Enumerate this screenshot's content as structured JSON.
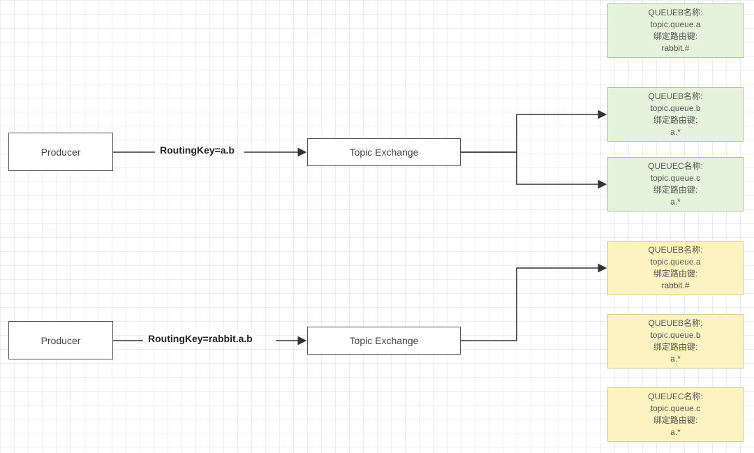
{
  "producers": [
    {
      "label": "Producer",
      "routing_key_label": "RoutingKey=a.b"
    },
    {
      "label": "Producer",
      "routing_key_label": "RoutingKey=rabbit.a.b"
    }
  ],
  "exchange_label": "Topic Exchange",
  "queues_top": [
    {
      "l1": "QUEUEB名称:",
      "l2": "topic.queue.a",
      "l3": "绑定路由键:",
      "l4": "rabbit.#"
    },
    {
      "l1": "QUEUEB名称:",
      "l2": "topic.queue.b",
      "l3": "绑定路由键:",
      "l4": "a.*"
    },
    {
      "l1": "QUEUEC名称:",
      "l2": "topic.queue.c",
      "l3": "绑定路由键:",
      "l4": "a.*"
    }
  ],
  "queues_bottom": [
    {
      "l1": "QUEUEB名称:",
      "l2": "topic.queue.a",
      "l3": "绑定路由键:",
      "l4": "rabbit.#"
    },
    {
      "l1": "QUEUEB名称:",
      "l2": "topic.queue.b",
      "l3": "绑定路由键:",
      "l4": "a.*"
    },
    {
      "l1": "QUEUEC名称:",
      "l2": "topic.queue.c",
      "l3": "绑定路由键:",
      "l4": "a.*"
    }
  ],
  "colors": {
    "green": "#e6f3dc",
    "yellow": "#fdf3c0"
  }
}
